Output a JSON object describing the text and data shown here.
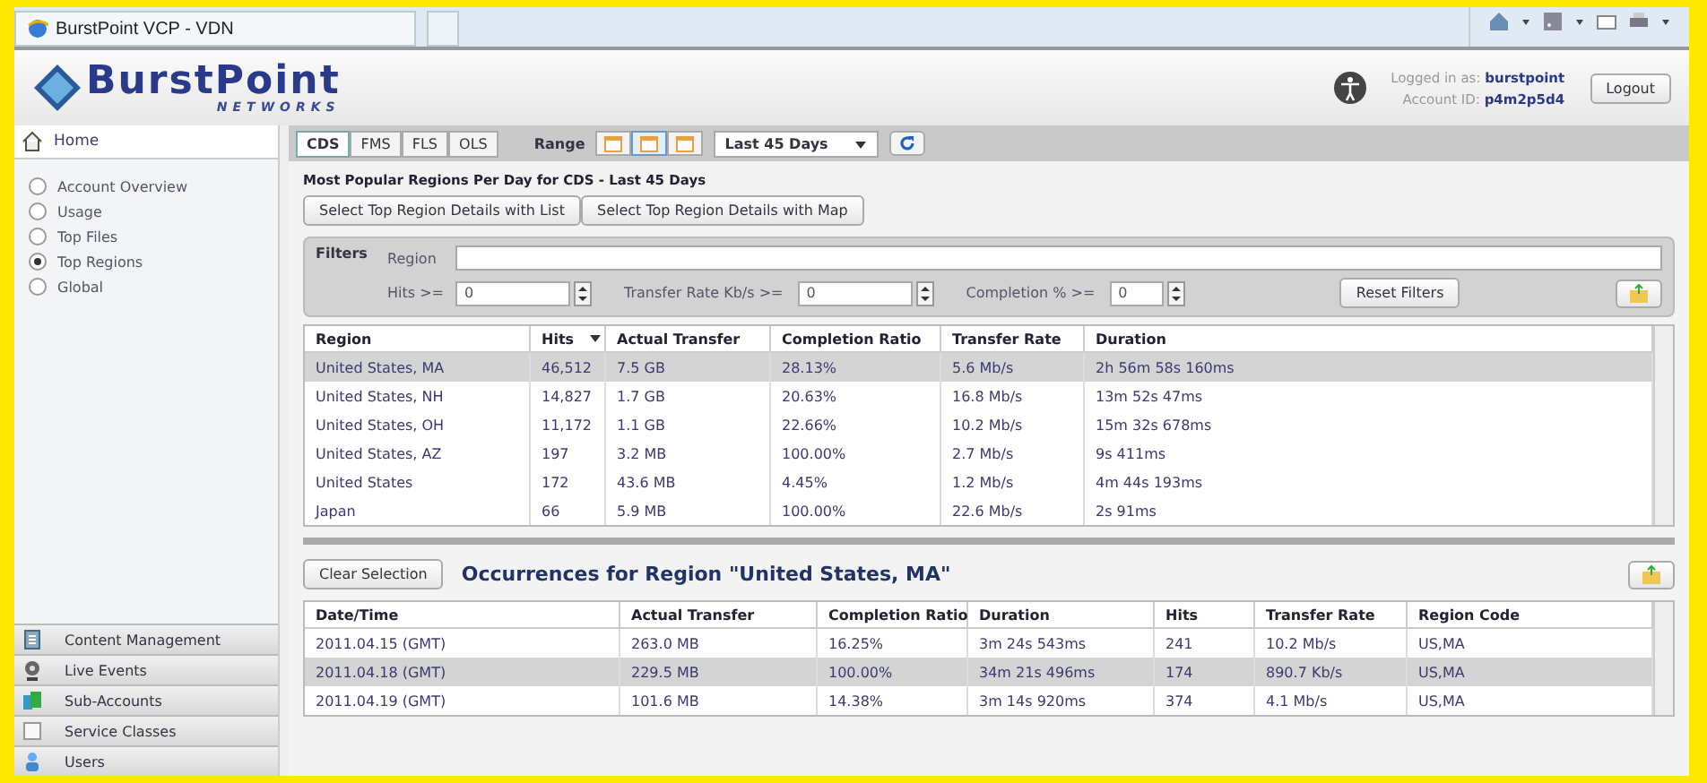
{
  "browser": {
    "tab_title": "BurstPoint VCP - VDN"
  },
  "header": {
    "logo": "BurstPoint",
    "logo_sub": "NETWORKS",
    "logged_label": "Logged in as:",
    "user": "burstpoint",
    "account_label": "Account ID:",
    "account": "p4m2p5d4",
    "logout": "Logout"
  },
  "sidebar": {
    "home": "Home",
    "items": [
      {
        "label": "Account Overview",
        "selected": false
      },
      {
        "label": "Usage",
        "selected": false
      },
      {
        "label": "Top Files",
        "selected": false
      },
      {
        "label": "Top Regions",
        "selected": true
      },
      {
        "label": "Global",
        "selected": false
      }
    ],
    "sections": [
      {
        "label": "Content Management",
        "kind": "content"
      },
      {
        "label": "Live Events",
        "kind": "live"
      },
      {
        "label": "Sub-Accounts",
        "kind": "sub"
      },
      {
        "label": "Service Classes",
        "kind": "service"
      },
      {
        "label": "Users",
        "kind": "users"
      }
    ]
  },
  "toolbar": {
    "tabs": [
      {
        "label": "CDS",
        "selected": true
      },
      {
        "label": "FMS",
        "selected": false
      },
      {
        "label": "FLS",
        "selected": false
      },
      {
        "label": "OLS",
        "selected": false
      }
    ],
    "range_label": "Range",
    "range_buttons": [
      {
        "selected": false
      },
      {
        "selected": true
      },
      {
        "selected": false
      }
    ],
    "period": "Last 45 Days"
  },
  "content": {
    "title": "Most Popular Regions Per Day for CDS - Last 45 Days",
    "view_buttons": [
      "Select Top Region Details with List",
      "Select Top Region Details with Map"
    ],
    "filters": {
      "label": "Filters",
      "region_label": "Region",
      "hits_label": "Hits >=",
      "hits": "0",
      "rate_label": "Transfer Rate Kb/s >=",
      "rate": "0",
      "completion_label": "Completion % >=",
      "completion": "0",
      "reset": "Reset Filters"
    },
    "table": {
      "columns": [
        {
          "label": "Region",
          "sorted": false
        },
        {
          "label": "Hits",
          "sorted": true
        },
        {
          "label": "Actual Transfer",
          "sorted": false
        },
        {
          "label": "Completion Ratio",
          "sorted": false
        },
        {
          "label": "Transfer Rate",
          "sorted": false
        },
        {
          "label": "Duration",
          "sorted": false
        }
      ],
      "rows": [
        {
          "selected": true,
          "cells": [
            "United States, MA",
            "46,512",
            "7.5 GB",
            "28.13%",
            "5.6 Mb/s",
            "2h 56m 58s 160ms"
          ]
        },
        {
          "selected": false,
          "cells": [
            "United States, NH",
            "14,827",
            "1.7 GB",
            "20.63%",
            "16.8 Mb/s",
            "13m 52s 47ms"
          ]
        },
        {
          "selected": false,
          "cells": [
            "United States, OH",
            "11,172",
            "1.1 GB",
            "22.66%",
            "10.2 Mb/s",
            "15m 32s 678ms"
          ]
        },
        {
          "selected": false,
          "cells": [
            "United States, AZ",
            "197",
            "3.2 MB",
            "100.00%",
            "2.7 Mb/s",
            "9s 411ms"
          ]
        },
        {
          "selected": false,
          "cells": [
            "United States",
            "172",
            "43.6 MB",
            "4.45%",
            "1.2 Mb/s",
            "4m 44s 193ms"
          ]
        },
        {
          "selected": false,
          "cells": [
            "Japan",
            "66",
            "5.9 MB",
            "100.00%",
            "22.6 Mb/s",
            "2s 91ms"
          ]
        }
      ]
    }
  },
  "occurrences": {
    "clear": "Clear Selection",
    "title": "Occurrences for Region \"United States, MA\"",
    "columns": [
      "Date/Time",
      "Actual Transfer",
      "Completion Ratio",
      "Duration",
      "Hits",
      "Transfer Rate",
      "Region Code"
    ],
    "rows": [
      {
        "selected": false,
        "cells": [
          "2011.04.15 (GMT)",
          "263.0 MB",
          "16.25%",
          "3m 24s 543ms",
          "241",
          "10.2 Mb/s",
          "US,MA"
        ]
      },
      {
        "selected": true,
        "cells": [
          "2011.04.18 (GMT)",
          "229.5 MB",
          "100.00%",
          "34m 21s 496ms",
          "174",
          "890.7 Kb/s",
          "US,MA"
        ]
      },
      {
        "selected": false,
        "cells": [
          "2011.04.19 (GMT)",
          "101.6 MB",
          "14.38%",
          "3m 14s 920ms",
          "374",
          "4.1 Mb/s",
          "US,MA"
        ]
      }
    ]
  }
}
